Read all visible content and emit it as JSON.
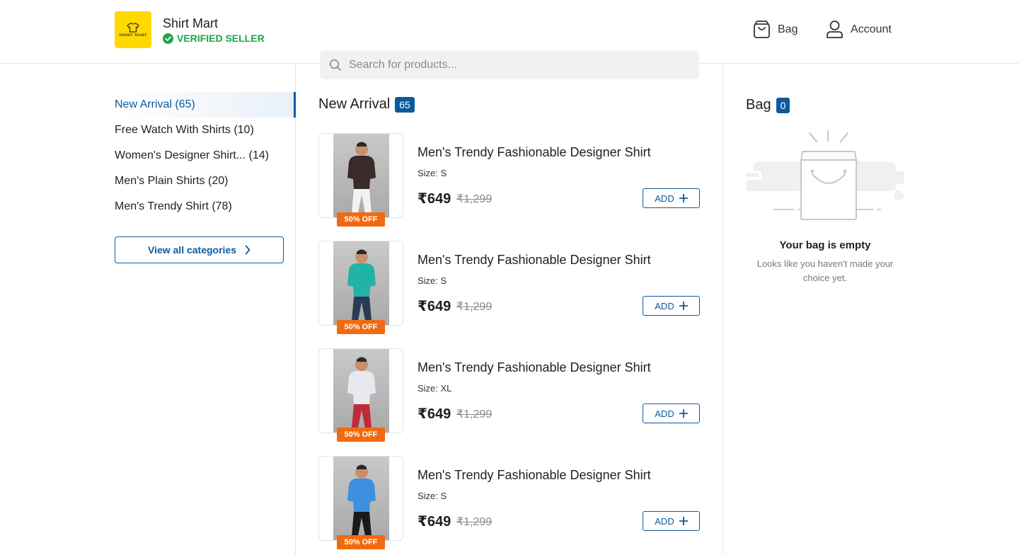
{
  "header": {
    "store_name": "Shirt Mart",
    "verified_label": "VERIFIED SELLER",
    "logo_text": "SHIRT MART",
    "bag_label": "Bag",
    "account_label": "Account"
  },
  "search": {
    "placeholder": "Search for products..."
  },
  "sidebar": {
    "categories": [
      {
        "label": "New Arrival (65)",
        "active": true
      },
      {
        "label": "Free Watch With Shirts (10)",
        "active": false
      },
      {
        "label": "Women's Designer Shirt... (14)",
        "active": false
      },
      {
        "label": "Men's Plain Shirts (20)",
        "active": false
      },
      {
        "label": "Men's Trendy Shirt (78)",
        "active": false
      }
    ],
    "view_all_label": "View all categories"
  },
  "main": {
    "section_title": "New Arrival",
    "section_count": "65",
    "products": [
      {
        "name": "Men's Trendy Fashionable Designer Shirt",
        "size": "Size: S",
        "price": "₹649",
        "mrp": "₹1,299",
        "discount": "50% OFF",
        "add_label": "ADD",
        "shirt_color": "#3a2a2a",
        "pants_color": "#f2f2f2"
      },
      {
        "name": "Men's Trendy Fashionable Designer Shirt",
        "size": "Size: S",
        "price": "₹649",
        "mrp": "₹1,299",
        "discount": "50% OFF",
        "add_label": "ADD",
        "shirt_color": "#22b3a8",
        "pants_color": "#2c3a55"
      },
      {
        "name": "Men's Trendy Fashionable Designer Shirt",
        "size": "Size: XL",
        "price": "₹649",
        "mrp": "₹1,299",
        "discount": "50% OFF",
        "add_label": "ADD",
        "shirt_color": "#e8e8f0",
        "pants_color": "#c02a3a"
      },
      {
        "name": "Men's Trendy Fashionable Designer Shirt",
        "size": "Size: S",
        "price": "₹649",
        "mrp": "₹1,299",
        "discount": "50% OFF",
        "add_label": "ADD",
        "shirt_color": "#3f8fe0",
        "pants_color": "#1a1a1a"
      }
    ]
  },
  "bag": {
    "title": "Bag",
    "count": "0",
    "empty_title": "Your bag is empty",
    "empty_subtitle": "Looks like you haven't made your choice yet."
  },
  "colors": {
    "accent": "#0c5a9e",
    "verified_green": "#1fa34a",
    "discount_orange": "#f26a10",
    "logo_yellow": "#ffd900"
  }
}
